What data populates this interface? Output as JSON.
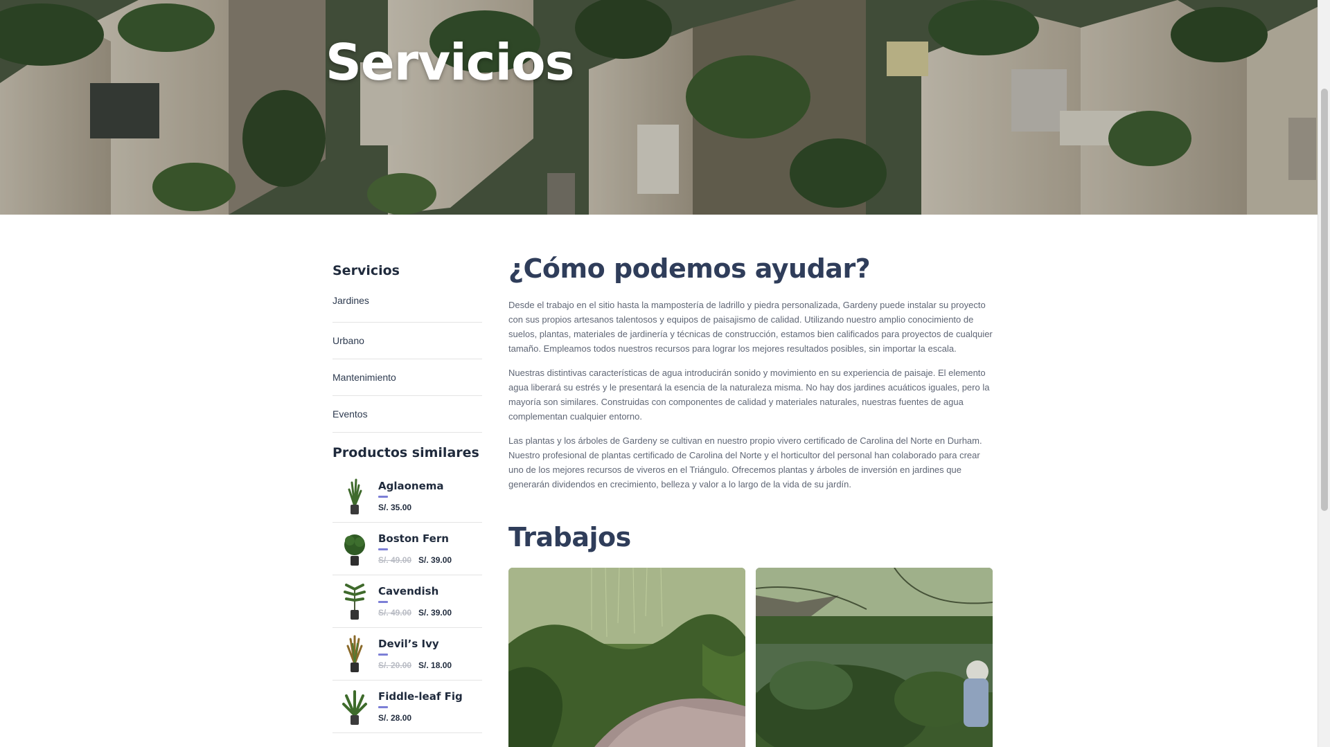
{
  "hero": {
    "title": "Servicios"
  },
  "sidebar": {
    "services_heading": "Servicios",
    "services": [
      {
        "label": "Jardines"
      },
      {
        "label": "Urbano"
      },
      {
        "label": "Mantenimiento"
      },
      {
        "label": "Eventos"
      }
    ],
    "products_heading": "Productos similares",
    "products": [
      {
        "name": "Aglaonema",
        "old_price": "",
        "price": "S/. 35.00",
        "icon": "plant-icon"
      },
      {
        "name": "Boston Fern",
        "old_price": "S/. 49.00",
        "price": "S/. 39.00",
        "icon": "plant-icon"
      },
      {
        "name": "Cavendish",
        "old_price": "S/. 49.00",
        "price": "S/. 39.00",
        "icon": "plant-icon"
      },
      {
        "name": "Devil’s Ivy",
        "old_price": "S/. 20.00",
        "price": "S/. 18.00",
        "icon": "plant-icon"
      },
      {
        "name": "Fiddle-leaf Fig",
        "old_price": "",
        "price": "S/. 28.00",
        "icon": "plant-icon"
      }
    ]
  },
  "main": {
    "title": "¿Cómo podemos ayudar?",
    "paragraphs": [
      "Desde el trabajo en el sitio hasta la mampostería de ladrillo y piedra personalizada, Gardeny puede instalar su proyecto con sus propios artesanos talentosos y equipos de paisajismo de calidad. Utilizando nuestro amplio conocimiento de suelos, plantas, materiales de jardinería y técnicas de construcción, estamos bien calificados para proyectos de cualquier tamaño. Empleamos todos nuestros recursos para lograr los mejores resultados posibles, sin importar la escala.",
      "Nuestras distintivas características de agua introducirán sonido y movimiento en su experiencia de paisaje. El elemento agua liberará su estrés y le presentará la esencia de la naturaleza misma. No hay dos jardines acuáticos iguales, pero la mayoría son similares. Construidas con componentes de calidad y materiales naturales, nuestras fuentes de agua complementan cualquier entorno.",
      "Las plantas y los árboles de Gardeny se cultivan en nuestro propio vivero certificado de Carolina del Norte en Durham. Nuestro profesional de plantas certificado de Carolina del Norte y el horticultor del personal han colaborado para crear uno de los mejores recursos de viveros en el Triángulo. Ofrecemos plantas y árboles de inversión en jardines que generarán dividendos en crecimiento, belleza y valor a lo largo de la vida de su jardín."
    ],
    "works_title": "Trabajos"
  },
  "colors": {
    "accent": "#7c7fd6",
    "heading": "#2f3d5a"
  }
}
